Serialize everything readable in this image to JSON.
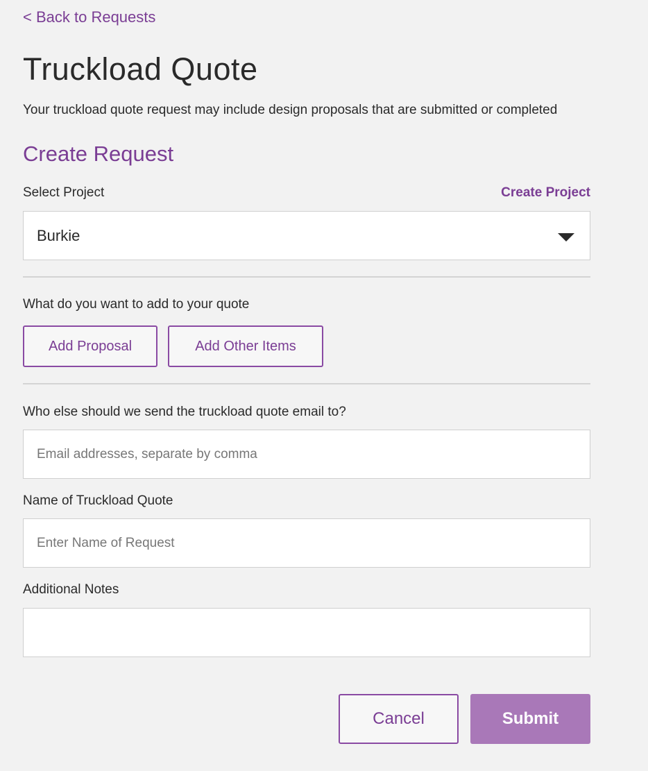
{
  "header": {
    "back_link": "< Back to Requests",
    "title": "Truckload Quote",
    "subtitle": "Your truckload quote request may include design proposals that are submitted or completed"
  },
  "form": {
    "section_title": "Create Request",
    "project": {
      "label": "Select Project",
      "create_link": "Create Project",
      "selected_value": "Burkie"
    },
    "add_items": {
      "label": "What do you want to add to your quote",
      "add_proposal_label": "Add Proposal",
      "add_other_items_label": "Add Other Items"
    },
    "emails": {
      "label": "Who else should we send the truckload quote email to?",
      "placeholder": "Email addresses, separate by comma",
      "value": ""
    },
    "quote_name": {
      "label": "Name of Truckload Quote",
      "placeholder": "Enter Name of Request",
      "value": ""
    },
    "notes": {
      "label": "Additional Notes",
      "value": ""
    }
  },
  "actions": {
    "cancel_label": "Cancel",
    "submit_label": "Submit"
  },
  "colors": {
    "accent": "#7a3d94",
    "submit_bg": "#a978b8",
    "page_bg": "#f2f2f2"
  },
  "icons": {
    "project_select": "chevron-down-icon"
  }
}
